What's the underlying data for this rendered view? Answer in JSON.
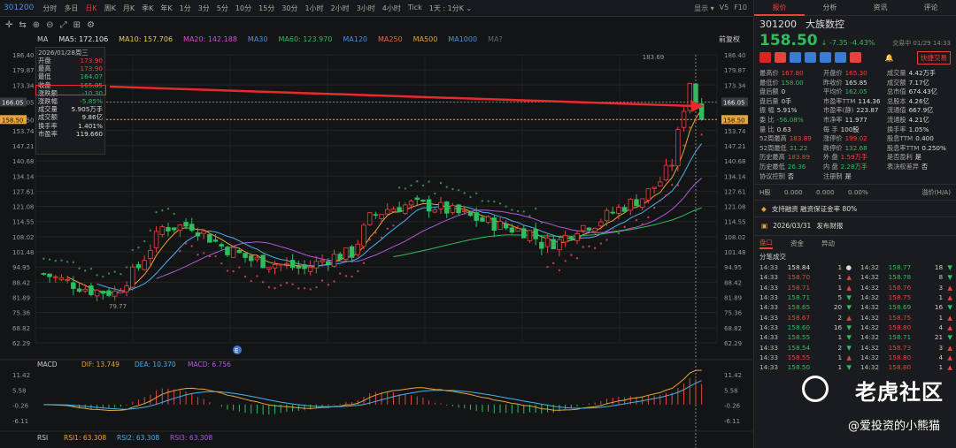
{
  "topbar": {
    "code": "301200",
    "periods": [
      "分时",
      "多日",
      "日K",
      "周K",
      "月K",
      "季K",
      "年K",
      "1分",
      "3分",
      "5分",
      "10分",
      "15分",
      "30分",
      "1小时",
      "2小时",
      "3小时",
      "4小时",
      "Tick",
      "1天 : 1分K ⌄"
    ],
    "active_period": "日K",
    "right": [
      "显示 ▾",
      "V5",
      "F10"
    ]
  },
  "legend": {
    "ma_label": "MA",
    "items": [
      {
        "label": "MA5: 172.106",
        "color": "#e8e8e8"
      },
      {
        "label": "MA10: 157.706",
        "color": "#e8d04b"
      },
      {
        "label": "MA20: 142.188",
        "color": "#d84bd8"
      },
      {
        "label": "MA30",
        "color": "#4a90e2"
      },
      {
        "label": "MA60: 123.970",
        "color": "#2ebd5f"
      },
      {
        "label": "MA120",
        "color": "#4a90e2"
      },
      {
        "label": "MA250",
        "color": "#e86a3b"
      },
      {
        "label": "MA500",
        "color": "#e8a43b"
      },
      {
        "label": "MA1000",
        "color": "#4a90e2"
      },
      {
        "label": "MA?",
        "color": "#666"
      }
    ],
    "right": "前复权",
    "extra": "147.143"
  },
  "infobox": {
    "date": "2026/01/28周三",
    "rows": [
      {
        "k": "开盘",
        "v": "173.90",
        "c": "red"
      },
      {
        "k": "最高",
        "v": "173.90",
        "c": "red"
      },
      {
        "k": "最低",
        "v": "164.07",
        "c": "grn"
      },
      {
        "k": "收盘",
        "v": "165.85",
        "c": "grn"
      },
      {
        "k": "涨跌额",
        "v": "-10.30",
        "c": "grn"
      },
      {
        "k": "涨跌幅",
        "v": "-5.85%",
        "c": "grn"
      },
      {
        "k": "成交量",
        "v": "5.905万手",
        "c": "wht"
      },
      {
        "k": "成交额",
        "v": "9.86亿",
        "c": "wht"
      },
      {
        "k": "换手率",
        "v": "1.401%",
        "c": "wht"
      },
      {
        "k": "市盈率",
        "v": "119.660",
        "c": "wht"
      }
    ]
  },
  "axis": {
    "price": [
      "186.40",
      "179.87",
      "173.34",
      "166.05",
      "158.50",
      "153.74",
      "147.21",
      "140.68",
      "134.14",
      "127.61",
      "121.08",
      "114.55",
      "108.02",
      "101.48",
      "94.95",
      "88.42",
      "81.89",
      "75.36",
      "68.82",
      "62.29"
    ],
    "macd": [
      "11.42",
      "5.58",
      "-0.26",
      "-6.11"
    ],
    "hi": "183.69",
    "lo": "79.77",
    "cur": "166.05",
    "last": "158.50"
  },
  "macd": {
    "title": "MACD",
    "dif": "DIF: 13.749",
    "dea": "DEA: 10.370",
    "macd": "MACD: 6.756"
  },
  "rsi": {
    "title": "RSI",
    "r1": "RSI1: 63.308",
    "r2": "RSI2: 63.308",
    "r3": "RSI3: 63.308"
  },
  "right": {
    "tabs": [
      "报价",
      "分析",
      "资讯",
      "评论"
    ],
    "code": "301200",
    "name": "大族数控",
    "price": "158.50",
    "change": "↓ -7.35 -4.43%",
    "tradetime": "交易中 01/29 14:33",
    "quick": "快捷交易",
    "quote": [
      [
        "最高价",
        "167.80",
        "red"
      ],
      [
        "开盘价",
        "165.30",
        "red"
      ],
      [
        "成交量",
        "4.42万手",
        "wht"
      ],
      [
        "最低价",
        "158.00",
        "grn"
      ],
      [
        "昨收价",
        "165.85",
        "wht"
      ],
      [
        "成交额",
        "7.17亿",
        "wht"
      ],
      [
        "盘后额",
        "0",
        "wht"
      ],
      [
        "平均价",
        "162.05",
        "grn"
      ],
      [
        "总市值",
        "674.43亿",
        "wht"
      ],
      [
        "盘后量",
        "0手",
        "wht"
      ],
      [
        "市盈率TTM",
        "114.36",
        "wht"
      ],
      [
        "总股本",
        "4.26亿",
        "wht"
      ],
      [
        "振 幅",
        "5.91%",
        "wht"
      ],
      [
        "市盈率(静)",
        "223.87",
        "wht"
      ],
      [
        "流通值",
        "667.9亿",
        "wht"
      ],
      [
        "委 比",
        "-56.08%",
        "grn"
      ],
      [
        "市净率",
        "11.977",
        "wht"
      ],
      [
        "流通股",
        "4.21亿",
        "wht"
      ],
      [
        "量 比",
        "0.63",
        "wht"
      ],
      [
        "每 手",
        "100股",
        "wht"
      ],
      [
        "换手率",
        "1.05%",
        "wht"
      ],
      [
        "52周最高",
        "183.89",
        "red"
      ],
      [
        "涨停价",
        "199.02",
        "red"
      ],
      [
        "股息TTM",
        "0.400",
        "wht"
      ],
      [
        "52周最低",
        "31.22",
        "grn"
      ],
      [
        "跌停价",
        "132.68",
        "grn"
      ],
      [
        "股息率TTM",
        "0.250%",
        "wht"
      ],
      [
        "历史最高",
        "183.89",
        "red"
      ],
      [
        "外 盘",
        "1.59万手",
        "red"
      ],
      [
        "是否盈利",
        "是",
        "wht"
      ],
      [
        "历史最低",
        "26.36",
        "grn"
      ],
      [
        "内 盘",
        "2.28万手",
        "grn"
      ],
      [
        "表决权差异",
        "否",
        "wht"
      ],
      [
        "协议控制",
        "否",
        "wht"
      ],
      [
        "注册制",
        "是",
        "wht"
      ],
      [
        "",
        "",
        ""
      ]
    ],
    "hrow": [
      "H股",
      "0.000",
      "0.000",
      "0.00%",
      "溢价(H/A)"
    ],
    "notice1": "支持融资 融资保证金率 80%",
    "notice2_date": "2026/03/31",
    "notice2": "发布财报",
    "subtabs": [
      "盘口",
      "资金",
      "异动"
    ],
    "ticktitle": "分笔成交",
    "ticks_left": [
      [
        "14:33",
        "158.84",
        "1",
        "●"
      ],
      [
        "14:33",
        "158.70",
        "1",
        "▲"
      ],
      [
        "14:33",
        "158.71",
        "1",
        "▲"
      ],
      [
        "14:33",
        "158.71",
        "5",
        "▼"
      ],
      [
        "14:33",
        "158.65",
        "20",
        "▼"
      ],
      [
        "14:33",
        "158.67",
        "2",
        "▲"
      ],
      [
        "14:33",
        "158.60",
        "16",
        "▼"
      ],
      [
        "14:33",
        "158.55",
        "1",
        "▼"
      ],
      [
        "14:33",
        "158.54",
        "2",
        "▼"
      ],
      [
        "14:33",
        "158.55",
        "1",
        "▲"
      ],
      [
        "14:33",
        "158.50",
        "1",
        "▼"
      ]
    ],
    "ticks_right": [
      [
        "14:32",
        "158.77",
        "18",
        "▼"
      ],
      [
        "14:32",
        "158.78",
        "8",
        "▼"
      ],
      [
        "14:32",
        "158.76",
        "3",
        "▲"
      ],
      [
        "14:32",
        "158.75",
        "1",
        "▲"
      ],
      [
        "14:32",
        "158.69",
        "16",
        "▼"
      ],
      [
        "14:32",
        "158.75",
        "1",
        "▲"
      ],
      [
        "14:32",
        "158.80",
        "4",
        "▲"
      ],
      [
        "14:32",
        "158.71",
        "21",
        "▼"
      ],
      [
        "14:32",
        "158.73",
        "3",
        "▲"
      ],
      [
        "14:32",
        "158.80",
        "4",
        "▲"
      ],
      [
        "14:32",
        "158.80",
        "1",
        "▲"
      ]
    ]
  },
  "watermark": {
    "brand": "老虎社区",
    "author": "@爱投资的小熊猫"
  }
}
